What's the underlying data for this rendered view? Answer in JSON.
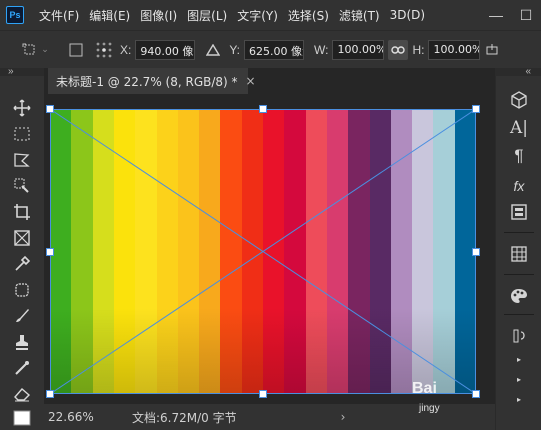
{
  "app": {
    "logo_text": "Ps"
  },
  "menu": [
    "文件(F)",
    "编辑(E)",
    "图像(I)",
    "图层(L)",
    "文字(Y)",
    "选择(S)",
    "滤镜(T)",
    "3D(D)"
  ],
  "window_controls": {
    "minimize": "—",
    "maximize": "☐"
  },
  "options": {
    "x_label": "X:",
    "x_value": "940.00 像素",
    "y_label": "Y:",
    "y_value": "625.00 像素",
    "w_label": "W:",
    "w_value": "100.00%",
    "h_label": "H:",
    "h_value": "100.00%"
  },
  "collapse": {
    "left": "»",
    "right": "«"
  },
  "document": {
    "tab_title": "未标题-1 @ 22.7% (8, RGB/8) *",
    "close": "×"
  },
  "stripe_colors": [
    "#3eae1f",
    "#8cc61a",
    "#d6de1c",
    "#fbe20c",
    "#fde21e",
    "#fcd21a",
    "#fbc31b",
    "#f8a91c",
    "#fb4c12",
    "#f02e16",
    "#e9122a",
    "#d4093d",
    "#ee4c5a",
    "#d83c6e",
    "#7a2560",
    "#592a64",
    "#b08cbf",
    "#c9c6dc",
    "#a6cfd8",
    "#01669a"
  ],
  "status": {
    "zoom": "22.66%",
    "doc_info": "文档:6.72M/0 字节",
    "arrow": "›"
  },
  "watermark": {
    "text": "Bai",
    "sub": "jingy"
  }
}
